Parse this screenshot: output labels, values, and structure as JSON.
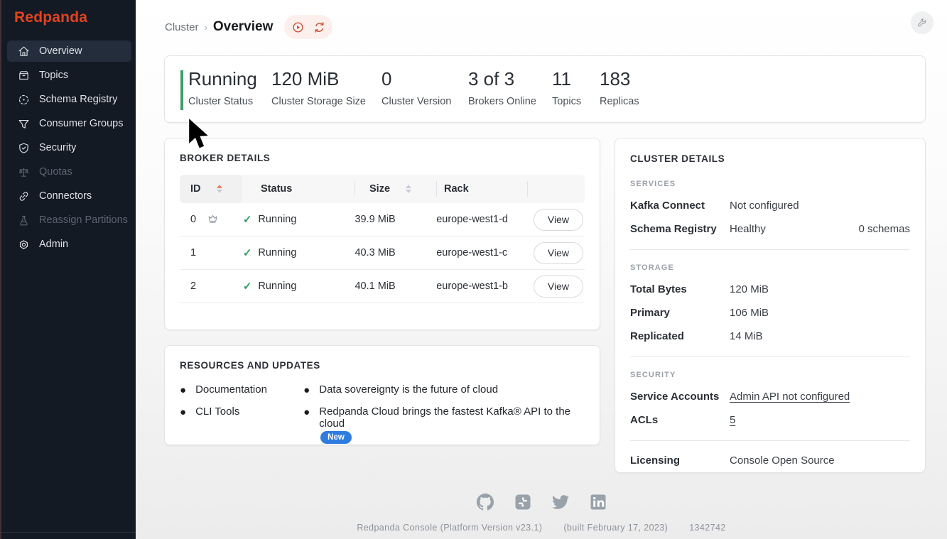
{
  "sidebar": {
    "logo": "Redpanda",
    "items": [
      {
        "label": "Overview",
        "icon": "home-icon",
        "active": true,
        "disabled": false
      },
      {
        "label": "Topics",
        "icon": "topics-icon",
        "active": false,
        "disabled": false
      },
      {
        "label": "Schema Registry",
        "icon": "schema-registry-icon",
        "active": false,
        "disabled": false
      },
      {
        "label": "Consumer Groups",
        "icon": "consumer-groups-icon",
        "active": false,
        "disabled": false
      },
      {
        "label": "Security",
        "icon": "security-icon",
        "active": false,
        "disabled": false
      },
      {
        "label": "Quotas",
        "icon": "quotas-icon",
        "active": false,
        "disabled": true
      },
      {
        "label": "Connectors",
        "icon": "connectors-icon",
        "active": false,
        "disabled": false
      },
      {
        "label": "Reassign Partitions",
        "icon": "reassign-partitions-icon",
        "active": false,
        "disabled": true
      },
      {
        "label": "Admin",
        "icon": "admin-icon",
        "active": false,
        "disabled": false
      }
    ]
  },
  "breadcrumb": {
    "parent": "Cluster",
    "current": "Overview"
  },
  "stats": [
    {
      "value": "Running",
      "label": "Cluster Status",
      "accent_bar_color": "#38a169"
    },
    {
      "value": "120 MiB",
      "label": "Cluster Storage Size"
    },
    {
      "value": "0",
      "label": "Cluster Version"
    },
    {
      "value": "3 of 3",
      "label": "Brokers Online"
    },
    {
      "value": "11",
      "label": "Topics"
    },
    {
      "value": "183",
      "label": "Replicas"
    }
  ],
  "broker_details": {
    "title": "BROKER DETAILS",
    "columns": {
      "id": "ID",
      "status": "Status",
      "size": "Size",
      "rack": "Rack"
    },
    "view_label": "View",
    "rows": [
      {
        "id": "0",
        "controller": true,
        "status": "Running",
        "size": "39.9 MiB",
        "rack": "europe-west1-d"
      },
      {
        "id": "1",
        "controller": false,
        "status": "Running",
        "size": "40.3 MiB",
        "rack": "europe-west1-c"
      },
      {
        "id": "2",
        "controller": false,
        "status": "Running",
        "size": "40.1 MiB",
        "rack": "europe-west1-b"
      }
    ]
  },
  "resources": {
    "title": "RESOURCES AND UPDATES",
    "left_links": [
      "Documentation",
      "CLI Tools"
    ],
    "right_links": [
      {
        "text": "Data sovereignty is the future of cloud",
        "badge": ""
      },
      {
        "text": "Redpanda Cloud brings the fastest Kafka® API to the cloud",
        "badge": "New"
      }
    ]
  },
  "cluster_details": {
    "title": "CLUSTER DETAILS",
    "services": {
      "heading": "SERVICES",
      "kafka_connect_label": "Kafka Connect",
      "kafka_connect_value": "Not configured",
      "schema_registry_label": "Schema Registry",
      "schema_registry_value": "Healthy",
      "schema_registry_extra": "0 schemas"
    },
    "storage": {
      "heading": "STORAGE",
      "total_bytes_label": "Total Bytes",
      "total_bytes_value": "120 MiB",
      "primary_label": "Primary",
      "primary_value": "106 MiB",
      "replicated_label": "Replicated",
      "replicated_value": "14 MiB"
    },
    "security": {
      "heading": "SECURITY",
      "service_accounts_label": "Service Accounts",
      "service_accounts_value": "Admin API not configured",
      "acls_label": "ACLs",
      "acls_value": "5"
    },
    "licensing": {
      "label": "Licensing",
      "value": "Console Open Source"
    }
  },
  "footer": {
    "icons": [
      "github-icon",
      "slack-icon",
      "twitter-icon",
      "linkedin-icon"
    ],
    "product": "Redpanda Console (Platform Version v23.1)",
    "built": "(built February 17, 2023)",
    "build_number": "1342742"
  },
  "colors": {
    "sidebar_bg": "#131a24",
    "brand_red": "#e2431f",
    "accent_orange": "#c64a2e",
    "status_green": "#38a169",
    "badge_blue": "#2f7ce0"
  }
}
